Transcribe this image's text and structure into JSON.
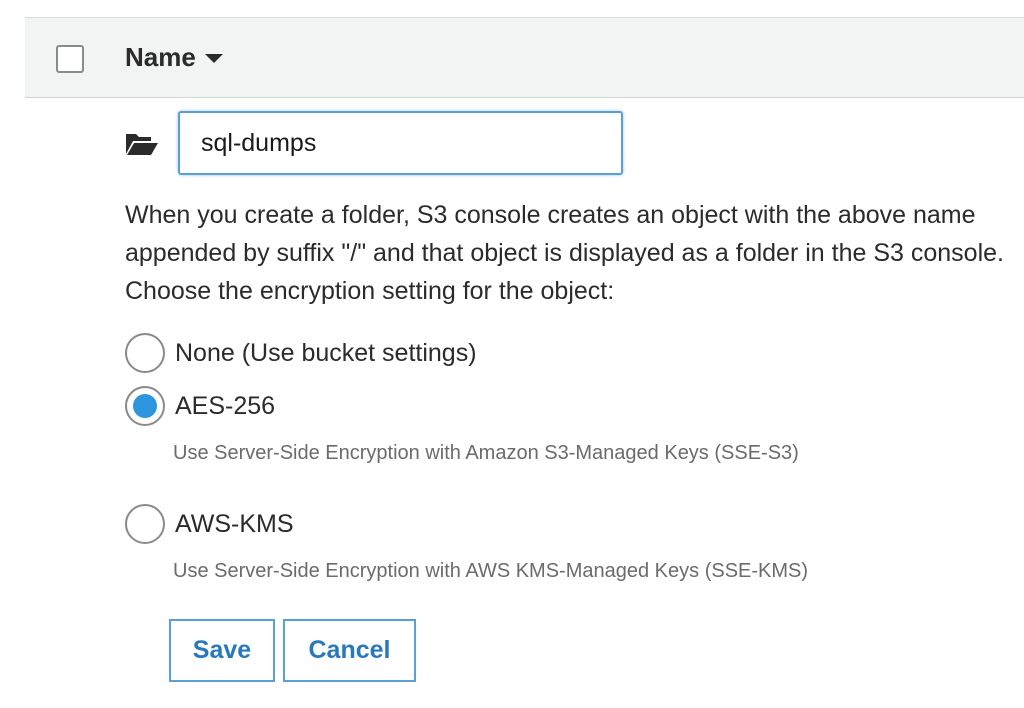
{
  "table_header": {
    "column_name": "Name",
    "sort_icon": "caret-down-icon"
  },
  "create_folder": {
    "folder_icon": "folder-open-icon",
    "input_value": "sql-dumps",
    "description": "When you create a folder, S3 console creates an object with the above name appended by suffix \"/\" and that object is displayed as a folder in the S3 console. Choose the encryption setting for the object:"
  },
  "encryption_options": [
    {
      "label": "None (Use bucket settings)",
      "help": "",
      "selected": false
    },
    {
      "label": "AES-256",
      "help": "Use Server-Side Encryption with Amazon S3-Managed Keys (SSE-S3)",
      "selected": true
    },
    {
      "label": "AWS-KMS",
      "help": "Use Server-Side Encryption with AWS KMS-Managed Keys (SSE-KMS)",
      "selected": false
    }
  ],
  "buttons": {
    "save_label": "Save",
    "cancel_label": "Cancel"
  },
  "colors": {
    "accent_blue": "#2d95e0",
    "button_text": "#2878be",
    "input_border": "#5aa0d6",
    "header_background": "#f2f3f3"
  }
}
